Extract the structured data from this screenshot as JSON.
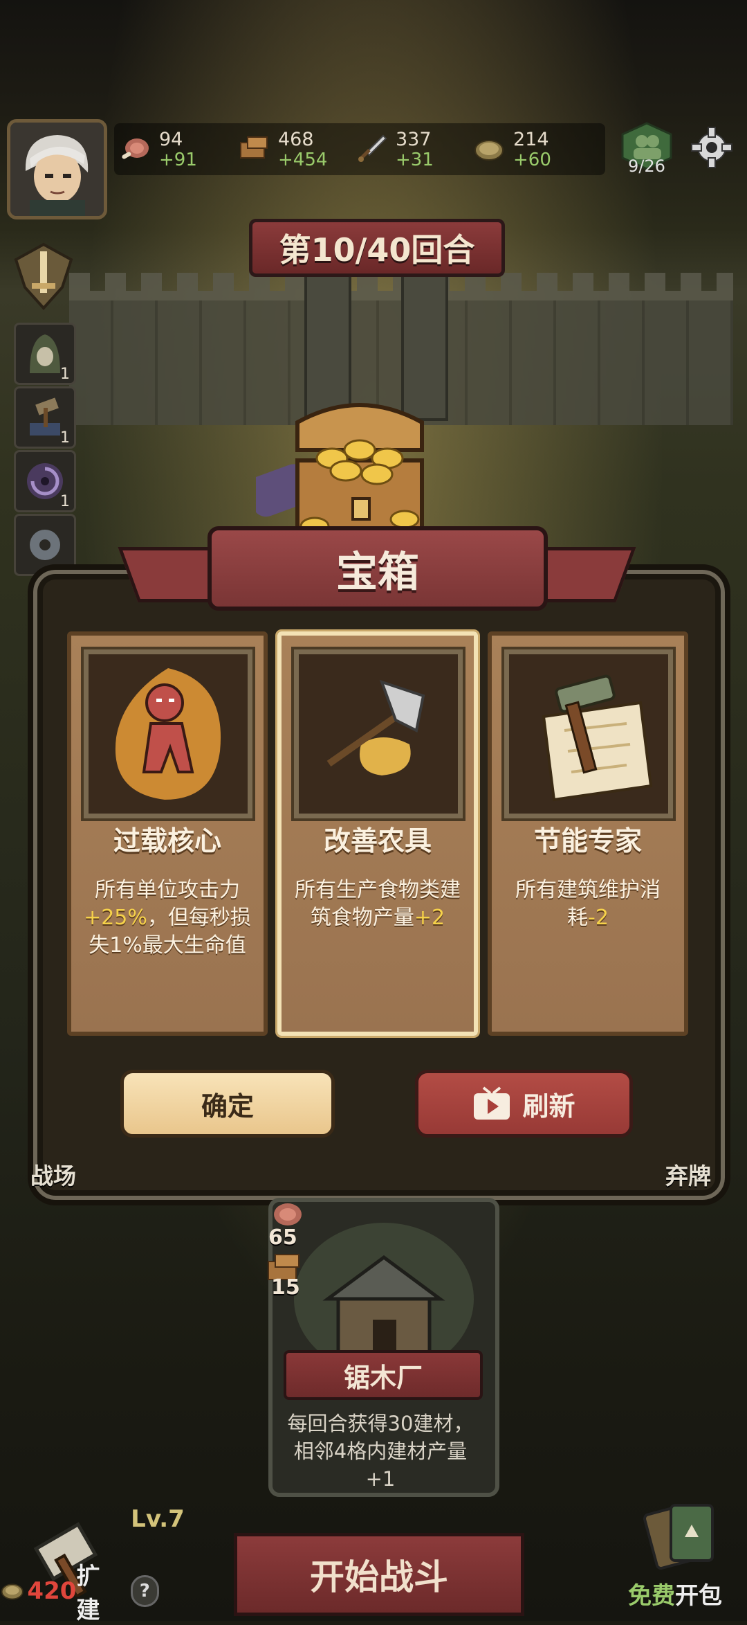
{
  "resources": [
    {
      "icon": "meat-icon",
      "value": "94",
      "delta": "+91"
    },
    {
      "icon": "wood-icon",
      "value": "468",
      "delta": "+454"
    },
    {
      "icon": "sword-icon",
      "value": "337",
      "delta": "+31"
    },
    {
      "icon": "coin-icon",
      "value": "214",
      "delta": "+60"
    }
  ],
  "population": "9/26",
  "round_label": "第10/40回合",
  "side_items": [
    {
      "icon": "hooded-unit-icon",
      "count": "1"
    },
    {
      "icon": "hammer-icon",
      "count": "1"
    },
    {
      "icon": "vortex-icon",
      "count": "1"
    },
    {
      "icon": "gear-sawblade-icon",
      "count": ""
    }
  ],
  "dialog": {
    "title": "宝箱",
    "options": [
      {
        "name": "过载核心",
        "desc_parts": [
          "所有单位攻击力",
          "+25%",
          "，但每秒损失1%最大生命值"
        ]
      },
      {
        "name": "改善农具",
        "desc_parts": [
          "所有生产食物类建筑食物产量",
          "+2",
          ""
        ]
      },
      {
        "name": "节能专家",
        "desc_parts": [
          "所有建筑维护消耗",
          "-2",
          ""
        ]
      }
    ],
    "confirm_label": "确定",
    "refresh_label": "刷新"
  },
  "left_label": "战场",
  "right_label": "弃牌",
  "building": {
    "food_cost": "65",
    "wood_cost": "15",
    "name": "锯木厂",
    "desc": "每回合获得30建材，相邻4格内建材产量+1"
  },
  "bottom": {
    "level": "Lv.7",
    "expand_cost": "420",
    "expand_label": "扩建",
    "help_label": "?",
    "start_label": "开始战斗",
    "free_label": "免费",
    "pack_label": "开包"
  },
  "colors": {
    "highlight": "#f6d24a",
    "positive_delta": "#9acb6b",
    "banner_red": "#8b3b3b"
  }
}
